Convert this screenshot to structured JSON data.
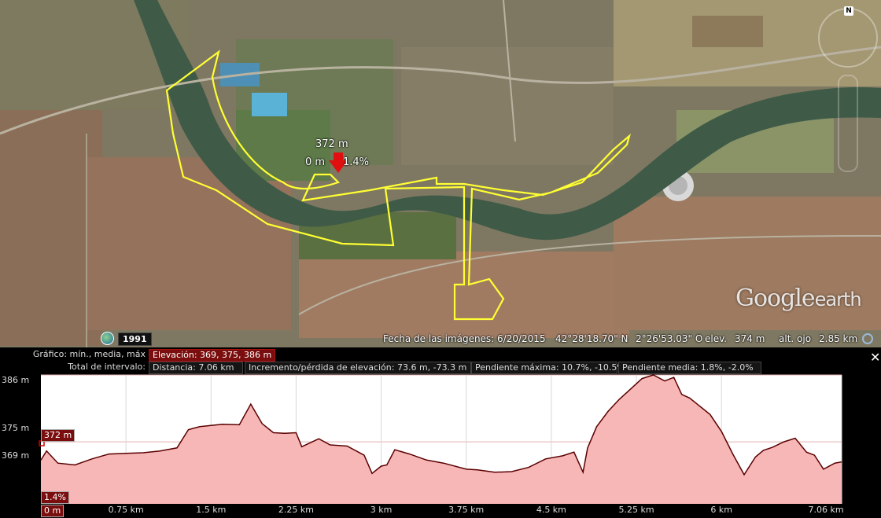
{
  "map": {
    "route_label_elevation": "372 m",
    "route_label_distance": "0 m",
    "route_label_slope": "1.4%",
    "year": "1991",
    "brand_google": "Google",
    "brand_earth": "earth",
    "compass_letter": "N",
    "status": {
      "imagery_date": "Fecha de las imágenes: 6/20/2015",
      "lat": "42°28'18.70\" N",
      "lon": "2°26'53.03\" O",
      "elev_label": "elev.",
      "elev_value": "374 m",
      "eye_label": "alt. ojo",
      "eye_value": "2.85 km"
    },
    "colors": {
      "route": "#ffff33",
      "river": "#3f5b47",
      "pin": "#e01010"
    }
  },
  "panel": {
    "graph_label": "Gráfico:",
    "graph_value": "mín., media, máx",
    "elevation": "Elevación: 369, 375, 386 m",
    "interval_label": "Total de intervalo:",
    "distance": "Distancia: 7.06 km",
    "gain_loss": "Incremento/pérdida de elevación: 73.6 m, -73.3 m",
    "max_slope": "Pendiente máxima: 10.7%, -10.5%",
    "avg_slope": "Pendiente media: 1.8%, -2.0%",
    "close": "✕",
    "cursor_elev": "372 m",
    "cursor_slope": "1.4%",
    "cursor_dist": "0 m"
  },
  "chart_data": {
    "type": "area",
    "xlabel": "",
    "ylabel": "",
    "y_ticks": [
      "386 m",
      "375 m",
      "369 m"
    ],
    "x_ticks": [
      "0.75 km",
      "1.5 km",
      "2.25 km",
      "3 km",
      "3.75 km",
      "4.5 km",
      "5.25 km",
      "6 km",
      "7.06 km"
    ],
    "ylim": [
      364.8,
      386
    ],
    "xlim": [
      0,
      7.06
    ],
    "series": [
      {
        "values_km": [
          0,
          0.05,
          0.15,
          0.3,
          0.45,
          0.6,
          0.75,
          0.9,
          1.05,
          1.2,
          1.3,
          1.4,
          1.5,
          1.6,
          1.75,
          1.85,
          1.95,
          2.05,
          2.15,
          2.25,
          2.3,
          2.45,
          2.55,
          2.7,
          2.85,
          2.92,
          3.0,
          3.05,
          3.12,
          3.25,
          3.4,
          3.55,
          3.75,
          3.85,
          4.0,
          4.15,
          4.3,
          4.45,
          4.6,
          4.7,
          4.78,
          4.82,
          4.9,
          5.0,
          5.1,
          5.2,
          5.3,
          5.4,
          5.5,
          5.58,
          5.65,
          5.72,
          5.8,
          5.9,
          6.0,
          6.1,
          6.2,
          6.3,
          6.37,
          6.45,
          6.55,
          6.65,
          6.75,
          6.82,
          6.9,
          7.0,
          7.06
        ],
        "elevation_m": [
          372,
          373.5,
          371.5,
          371.2,
          372.2,
          373,
          373.1,
          373.2,
          373.5,
          374,
          377,
          377.5,
          377.7,
          377.9,
          377.8,
          381.2,
          378,
          376.5,
          376.4,
          376.5,
          374.2,
          375.5,
          374.5,
          374.3,
          372.8,
          369.8,
          371,
          371.2,
          373.7,
          373,
          372,
          371.5,
          370.5,
          370.4,
          370,
          370.1,
          370.8,
          372.2,
          372.7,
          373.3,
          370,
          374,
          377.5,
          380,
          382,
          383.7,
          385.4,
          386,
          385,
          385.6,
          382.8,
          382.2,
          381,
          379.5,
          376.7,
          373,
          369.6,
          372.5,
          373.6,
          374.1,
          375,
          375.6,
          373.3,
          372.8,
          370.5,
          371.5,
          371.7
        ]
      }
    ]
  }
}
